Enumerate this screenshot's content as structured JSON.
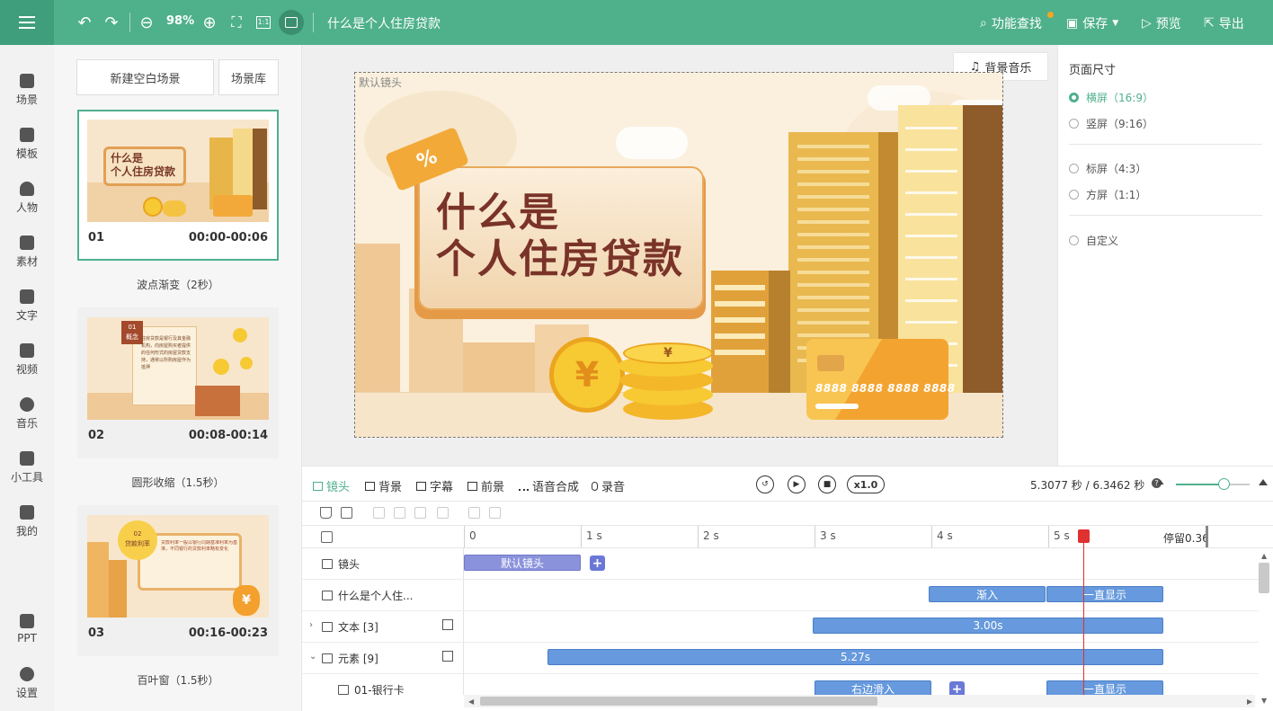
{
  "topbar": {
    "zoom": "98%",
    "doc_title": "什么是个人住房贷款",
    "actions": {
      "feature_search": "功能查找",
      "save": "保存",
      "preview": "预览",
      "export": "导出"
    }
  },
  "rail": {
    "items": [
      {
        "label": "场景"
      },
      {
        "label": "模板"
      },
      {
        "label": "人物"
      },
      {
        "label": "素材"
      },
      {
        "label": "文字"
      },
      {
        "label": "视频"
      },
      {
        "label": "音乐"
      },
      {
        "label": "小工具"
      },
      {
        "label": "我的"
      },
      {
        "label": "PPT"
      },
      {
        "label": "设置"
      }
    ]
  },
  "scenes": {
    "new_blank": "新建空白场景",
    "library": "场景库",
    "list": [
      {
        "num": "01",
        "time": "00:00-00:06",
        "transition": "波点渐变（2秒）",
        "thumb_title_1": "什么是",
        "thumb_title_2": "个人住房贷款"
      },
      {
        "num": "02",
        "time": "00:08-00:14",
        "transition": "圆形收缩（1.5秒）",
        "thumb_badge": "01",
        "thumb_badge_sub": "概念",
        "thumb_text": "住房贷款是银行及其金融机构，向房屋购买者提供的任何形式的房屋贷款支持，通常以所购房屋作为抵押"
      },
      {
        "num": "03",
        "time": "00:16-00:23",
        "transition": "百叶窗（1.5秒）",
        "thumb_badge": "02",
        "thumb_badge_sub": "贷款利率",
        "thumb_text": "贷款利率一般以银行同期基准利率为基准，不同银行的贷款利率略有变化"
      }
    ]
  },
  "stage": {
    "bgm": "背景音乐",
    "frame_label": "默认镜头",
    "title_line1": "什么是",
    "title_line2": "个人住房贷款",
    "percent": "%",
    "card_number": "8888 8888 8888 8888",
    "yen": "¥"
  },
  "props": {
    "title": "页面尺寸",
    "options": [
      {
        "label": "横屏（16:9）",
        "selected": true
      },
      {
        "label": "竖屏（9:16）",
        "selected": false
      },
      {
        "label": "标屏（4:3）",
        "selected": false
      },
      {
        "label": "方屏（1:1）",
        "selected": false
      },
      {
        "label": "自定义",
        "selected": false
      }
    ]
  },
  "timeline": {
    "tabs": [
      "镜头",
      "背景",
      "字幕",
      "前景",
      "语音合成",
      "录音"
    ],
    "speed": "x1.0",
    "time_readout": "5.3077 秒 / 6.3462 秒",
    "ticks": [
      "0",
      "1 s",
      "2 s",
      "3 s",
      "4 s",
      "5 s"
    ],
    "stay_label": "停留0.36",
    "rows": [
      {
        "label": "镜头",
        "clips": [
          {
            "text": "默认镜头"
          }
        ]
      },
      {
        "label": "什么是个人住...",
        "clips": [
          {
            "text": "渐入"
          },
          {
            "text": "一直显示"
          }
        ]
      },
      {
        "label": "文本 [3]",
        "clips": [
          {
            "text": "3.00s"
          }
        ]
      },
      {
        "label": "元素 [9]",
        "clips": [
          {
            "text": "5.27s"
          }
        ]
      },
      {
        "label": "01-银行卡",
        "clips": [
          {
            "text": "右边滑入"
          },
          {
            "text": "一直显示"
          }
        ]
      }
    ],
    "playhead_seconds": 5.3077,
    "total_seconds": 6.3462
  }
}
